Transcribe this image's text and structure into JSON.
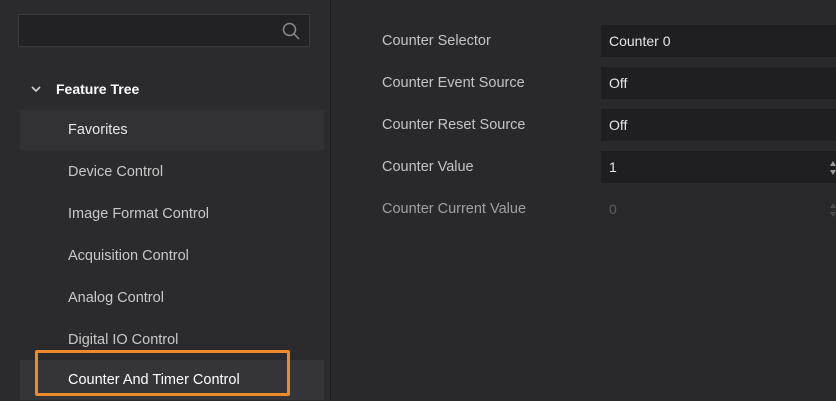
{
  "search": {
    "placeholder": ""
  },
  "tree": {
    "header": "Feature Tree",
    "items": [
      {
        "label": "Favorites"
      },
      {
        "label": "Device Control"
      },
      {
        "label": "Image Format Control"
      },
      {
        "label": "Acquisition Control"
      },
      {
        "label": "Analog Control"
      },
      {
        "label": "Digital IO Control"
      },
      {
        "label": "Counter And Timer Control"
      }
    ]
  },
  "properties": [
    {
      "label": "Counter Selector",
      "value": "Counter 0"
    },
    {
      "label": "Counter Event Source",
      "value": "Off"
    },
    {
      "label": "Counter Reset Source",
      "value": "Off"
    },
    {
      "label": "Counter Value",
      "value": "1"
    },
    {
      "label": "Counter Current Value",
      "value": "0"
    }
  ],
  "colors": {
    "highlight": "#ee8a2a",
    "panel_bg": "#2b2b2e",
    "field_bg": "#1f1f22"
  },
  "icons": {
    "search": "search-icon",
    "expand": "chevron-down-icon",
    "spinner": "spinner-arrows-icon"
  }
}
